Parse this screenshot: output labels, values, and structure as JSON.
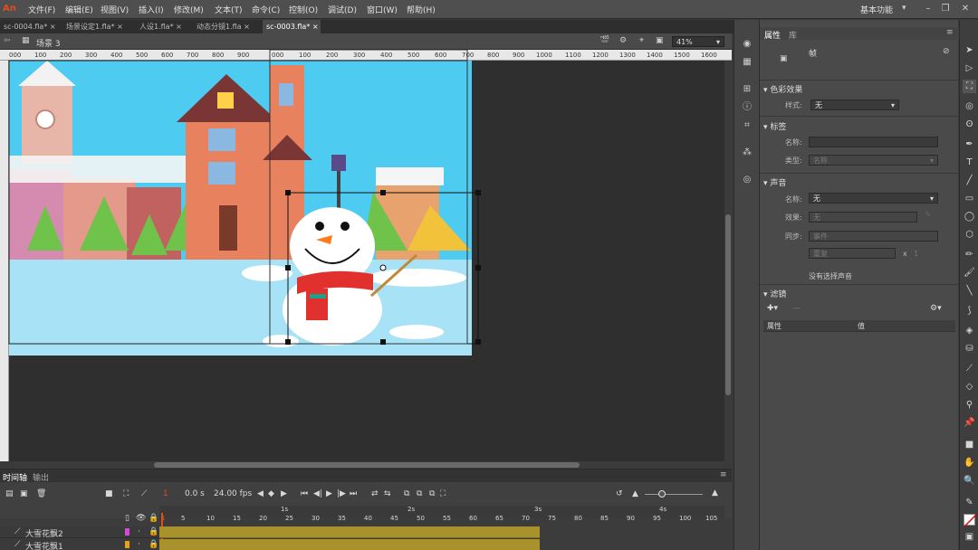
{
  "menu": [
    "文件(F)",
    "编辑(E)",
    "视图(V)",
    "插入(I)",
    "修改(M)",
    "文本(T)",
    "命令(C)",
    "控制(O)",
    "调试(D)",
    "窗口(W)",
    "帮助(H)"
  ],
  "logo": "An",
  "workspace": "基本功能",
  "tabs": [
    "sc-0004.fla*",
    "场景设定1.fla*",
    "人设1.fla*",
    "动态分镜1.fla",
    "sc-0003.fla*"
  ],
  "scene_label": "场景 3",
  "zoom": "41%",
  "ruler": [
    "000",
    "100",
    "200",
    "300",
    "400",
    "500",
    "600",
    "700",
    "800",
    "900",
    "1000",
    "1100",
    "1200",
    "1300",
    "1400",
    "1500",
    "1600"
  ],
  "timeline": {
    "tab1": "时间轴",
    "tab2": "输出",
    "time": "0.0 s",
    "fps": "24.00 fps",
    "frame_nums": [
      "1",
      "5",
      "10",
      "15",
      "20",
      "25",
      "30",
      "35",
      "40",
      "45",
      "50",
      "55",
      "60",
      "65",
      "70",
      "75",
      "80",
      "85",
      "90",
      "95",
      "100",
      "105"
    ],
    "secs": [
      "1s",
      "2s",
      "3s",
      "4s"
    ],
    "layers": [
      "大雪花飘2",
      "大雪花飘1"
    ]
  },
  "props": {
    "tab1": "属性",
    "tab2": "库",
    "frame_label": "帧",
    "color_effect": "色彩效果",
    "style_label": "样式:",
    "style_value": "无",
    "label_sect": "标签",
    "name_label": "名称:",
    "type_label": "类型:",
    "type_value": "名称",
    "sound_sect": "声音",
    "sound_name_label": "名称:",
    "sound_name_value": "无",
    "effect_label": "效果:",
    "effect_value": "无",
    "sync_label": "同步:",
    "sync_value": "事件",
    "repeat_value": "重复",
    "repeat_x": "x",
    "repeat_count": "1",
    "no_sound": "没有选择声音",
    "filter_sect": "滤镜",
    "col_prop": "属性",
    "col_val": "值"
  },
  "colors": {
    "sky": "#4ecbf0",
    "ground": "#a8e2f7",
    "accent": "#e04e1f",
    "frames": "#a9912b"
  }
}
